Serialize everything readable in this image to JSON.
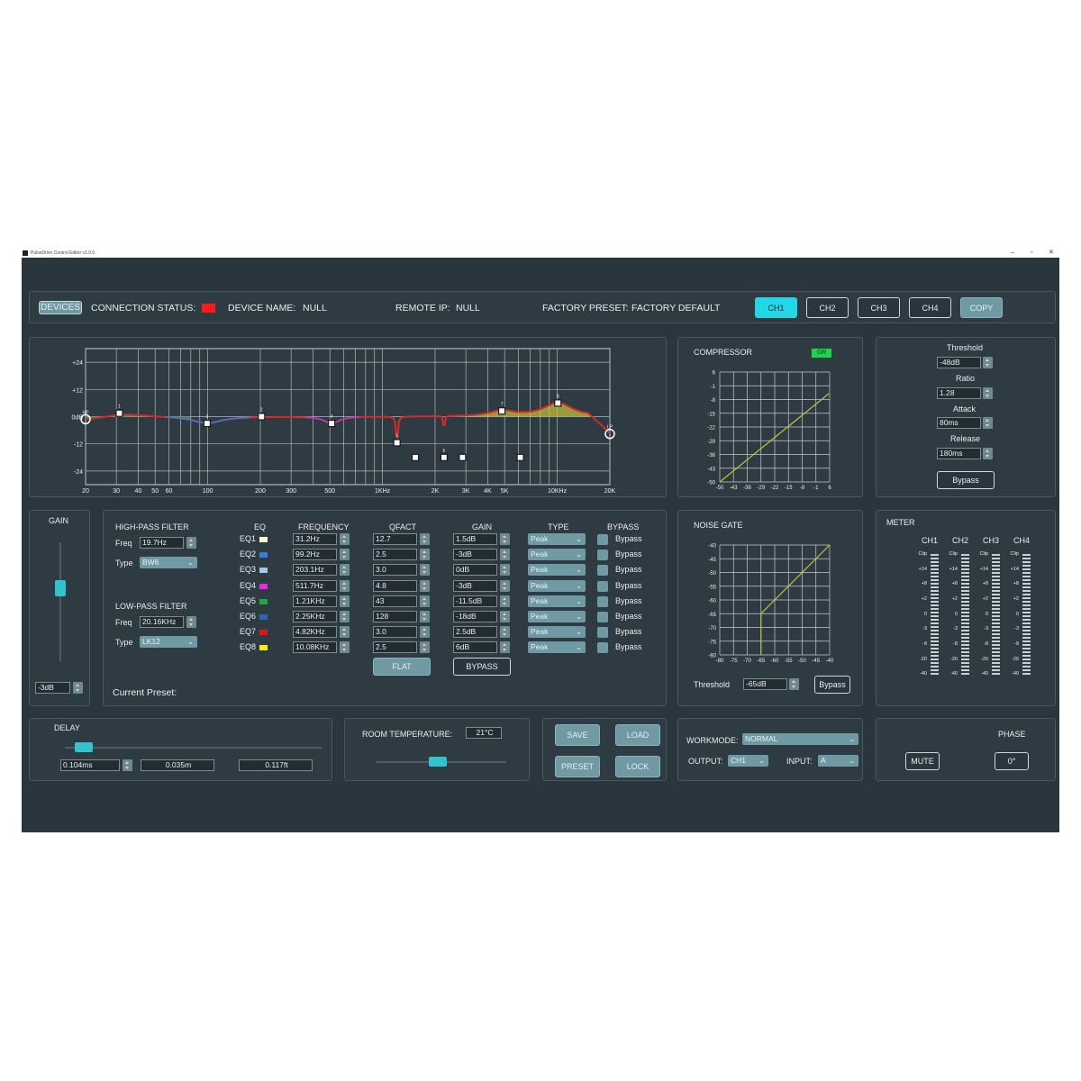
{
  "window": {
    "title": "PulseDrive Control Editor v1.0.5",
    "min": "–",
    "max": "▫",
    "close": "✕"
  },
  "header": {
    "devices_label": "DEVICES",
    "connection_status_label": "CONNECTION STATUS:",
    "connection_status_color": "#ff1a1a",
    "device_name_label": "DEVICE NAME:",
    "device_name_value": "NULL",
    "remote_ip_label": "REMOTE IP:",
    "remote_ip_value": "NULL",
    "factory_preset_label": "FACTORY PRESET:",
    "factory_preset_value": "FACTORY DEFAULT",
    "channels": [
      "CH1",
      "CH2",
      "CH3",
      "CH4"
    ],
    "active_channel": "CH1",
    "copy_label": "COPY"
  },
  "eq_graph": {
    "y_labels": [
      "+24",
      "+12",
      "0dB",
      "-12",
      "-24"
    ],
    "x_labels": [
      "20",
      "30",
      "40",
      "50",
      "60",
      "100",
      "200",
      "300",
      "500",
      "1KHz",
      "2K",
      "3K",
      "4K",
      "5K",
      "10KHz",
      "20K"
    ],
    "node_labels": [
      "HP",
      "1",
      "3",
      "2",
      "4",
      "5",
      "6",
      "7",
      "8",
      "LP"
    ]
  },
  "compressor": {
    "title": "COMPRESSOR",
    "gr_label": "GR",
    "y_labels": [
      "6",
      "-1",
      "-8",
      "-15",
      "-22",
      "-29",
      "-36",
      "-43",
      "-50"
    ],
    "x_labels": [
      "-50",
      "-43",
      "-36",
      "-29",
      "-22",
      "-15",
      "-8",
      "-1",
      "6"
    ],
    "threshold_label": "Threshold",
    "threshold_value": "-48dB",
    "ratio_label": "Ratio",
    "ratio_value": "1.28",
    "attack_label": "Attack",
    "attack_value": "80ms",
    "release_label": "Release",
    "release_value": "180ms",
    "bypass_label": "Bypass"
  },
  "gain": {
    "title": "GAIN",
    "value": "-3dB",
    "level": 0.63
  },
  "filters": {
    "hpf_title": "HIGH-PASS FILTER",
    "hpf_freq_label": "Freq",
    "hpf_freq": "19.7Hz",
    "hpf_type_label": "Type",
    "hpf_type": "BW6",
    "lpf_title": "LOW-PASS FILTER",
    "lpf_freq_label": "Freq",
    "lpf_freq": "20.16KHz",
    "lpf_type_label": "Type",
    "lpf_type": "LK12",
    "current_preset_label": "Current Preset:"
  },
  "eq_table": {
    "headers": [
      "EQ",
      "FREQUENCY",
      "QFACT",
      "GAIN",
      "TYPE",
      "BYPASS"
    ],
    "rows": [
      {
        "name": "EQ1",
        "color": "#fbf7d4",
        "freq": "31.2Hz",
        "q": "12.7",
        "gain": "1.5dB",
        "type": "Peak",
        "bypass": "Bypass"
      },
      {
        "name": "EQ2",
        "color": "#2f7fe0",
        "freq": "99.2Hz",
        "q": "2.5",
        "gain": "-3dB",
        "type": "Peak",
        "bypass": "Bypass"
      },
      {
        "name": "EQ3",
        "color": "#a9c3f0",
        "freq": "203.1Hz",
        "q": "3.0",
        "gain": "0dB",
        "type": "Peak",
        "bypass": "Bypass"
      },
      {
        "name": "EQ4",
        "color": "#e52ce0",
        "freq": "511.7Hz",
        "q": "4.8",
        "gain": "-3dB",
        "type": "Peak",
        "bypass": "Bypass"
      },
      {
        "name": "EQ5",
        "color": "#1fa84a",
        "freq": "1.21KHz",
        "q": "43",
        "gain": "-11.5dB",
        "type": "Peak",
        "bypass": "Bypass"
      },
      {
        "name": "EQ6",
        "color": "#2e65b5",
        "freq": "2.25KHz",
        "q": "128",
        "gain": "-18dB",
        "type": "Peak",
        "bypass": "Bypass"
      },
      {
        "name": "EQ7",
        "color": "#e61414",
        "freq": "4.82KHz",
        "q": "3.0",
        "gain": "2.5dB",
        "type": "Peak",
        "bypass": "Bypass"
      },
      {
        "name": "EQ8",
        "color": "#f5ee1a",
        "freq": "10.08KHz",
        "q": "2.5",
        "gain": "6dB",
        "type": "Peak",
        "bypass": "Bypass"
      }
    ],
    "flat_label": "FLAT",
    "bypass_label": "BYPASS"
  },
  "noise_gate": {
    "title": "NOISE GATE",
    "y_labels": [
      "-40",
      "-45",
      "-50",
      "-55",
      "-60",
      "-65",
      "-70",
      "-75",
      "-80"
    ],
    "x_labels": [
      "-80",
      "-75",
      "-70",
      "-65",
      "-60",
      "-55",
      "-50",
      "-45",
      "-40"
    ],
    "threshold_label": "Threshold",
    "threshold_value": "-65dB",
    "bypass_label": "Bypass"
  },
  "meter": {
    "title": "METER",
    "channels": [
      "CH1",
      "CH2",
      "CH3",
      "CH4"
    ],
    "scale": [
      "Clip",
      "+14",
      "+8",
      "+2",
      "0",
      "-3",
      "-8",
      "-20",
      "-40"
    ]
  },
  "delay": {
    "title": "DELAY",
    "ms": "0.104ms",
    "m": "0.035m",
    "ft": "0.117ft",
    "level": 0.04
  },
  "room": {
    "title": "ROOM TEMPERATURE:",
    "value": "21°C",
    "level": 0.47
  },
  "actions": {
    "save": "SAVE",
    "load": "LOAD",
    "preset": "PRESET",
    "lock": "LOCK"
  },
  "workmode": {
    "label": "WORKMODE:",
    "value": "NORMAL",
    "output_label": "OUTPUT:",
    "output_value": "CH1",
    "input_label": "INPUT:",
    "input_value": "A"
  },
  "phase": {
    "title": "PHASE",
    "mute_label": "MUTE",
    "value": "0°"
  }
}
